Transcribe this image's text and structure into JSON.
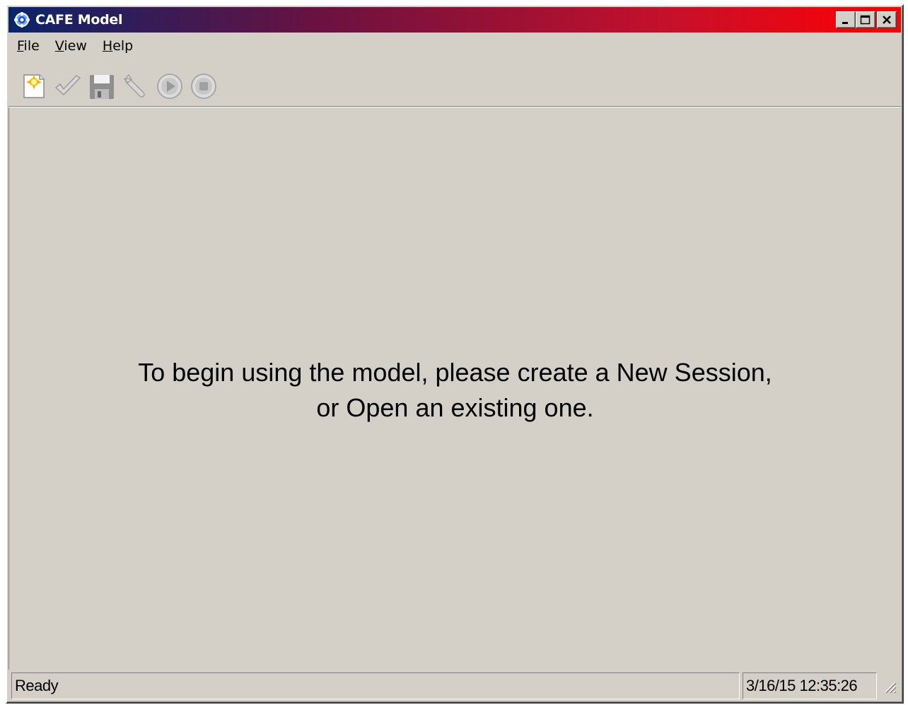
{
  "window": {
    "title": "CAFE Model",
    "icon": "gear-app-icon"
  },
  "caption_buttons": [
    "minimize-icon",
    "maximize-icon",
    "close-icon"
  ],
  "menu": {
    "items": [
      {
        "label": "File",
        "mnemonic": "F",
        "rest": "ile"
      },
      {
        "label": "View",
        "mnemonic": "V",
        "rest": "iew"
      },
      {
        "label": "Help",
        "mnemonic": "H",
        "rest": "elp"
      }
    ]
  },
  "toolbar": {
    "buttons": [
      {
        "icon": "new-session-icon",
        "enabled": true
      },
      {
        "icon": "checkmark-icon",
        "enabled": false
      },
      {
        "icon": "save-icon",
        "enabled": false
      },
      {
        "icon": "wrench-icon",
        "enabled": false
      },
      {
        "icon": "play-icon",
        "enabled": false
      },
      {
        "icon": "stop-icon",
        "enabled": false
      }
    ]
  },
  "main": {
    "message_line1": "To begin using the model, please create a New Session,",
    "message_line2": "or Open an existing one."
  },
  "status": {
    "text": "Ready",
    "datetime": "3/16/15 12:35:26"
  },
  "colors": {
    "titlebar_start": "#0a246a",
    "titlebar_end": "#ff0000",
    "window_bg": "#d4d0c8"
  }
}
